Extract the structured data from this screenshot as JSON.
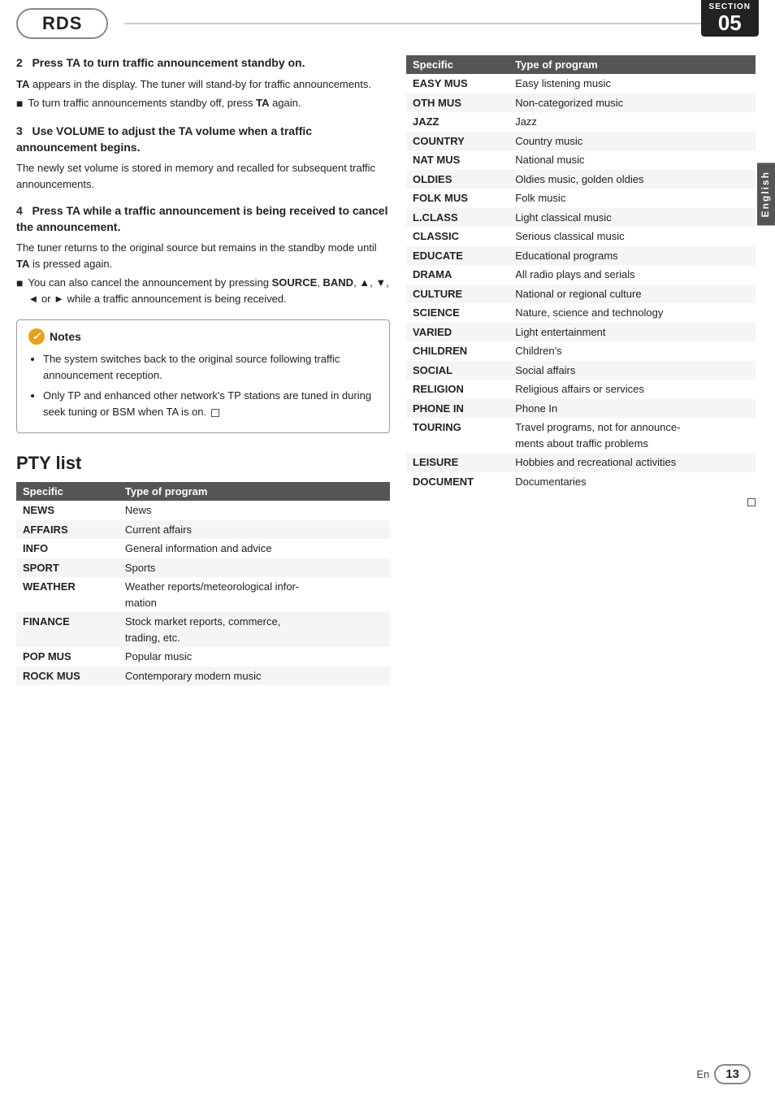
{
  "header": {
    "rds_label": "RDS",
    "section_label": "Section",
    "section_number": "05"
  },
  "sidebar": {
    "language": "English"
  },
  "steps": [
    {
      "id": "step2",
      "heading": "2   Press TA to turn traffic announcement standby on.",
      "paragraphs": [
        "TA appears in the display. The tuner will stand-by for traffic announcements.",
        "■   To turn traffic announcements standby off, press TA again."
      ]
    },
    {
      "id": "step3",
      "heading": "3   Use VOLUME to adjust the TA volume when a traffic announcement begins.",
      "paragraphs": [
        "The newly set volume is stored in memory and recalled for subsequent traffic announcements."
      ]
    },
    {
      "id": "step4",
      "heading": "4   Press TA while a traffic announcement is being received to cancel the announcement.",
      "paragraphs": [
        "The tuner returns to the original source but remains in the standby mode until TA is pressed again.",
        "■   You can also cancel the announcement by pressing SOURCE, BAND, ▲, ▼, ◄ or ► while a traffic announcement is being received."
      ]
    }
  ],
  "notes": {
    "title": "Notes",
    "items": [
      "The system switches back to the original source following traffic announcement reception.",
      "Only TP and enhanced other network's TP stations are tuned in during seek tuning or BSM when TA is on."
    ]
  },
  "pty_list": {
    "heading": "PTY list",
    "table1": {
      "headers": [
        "Specific",
        "Type of program"
      ],
      "rows": [
        [
          "NEWS",
          "News"
        ],
        [
          "AFFAIRS",
          "Current affairs"
        ],
        [
          "INFO",
          "General information and advice"
        ],
        [
          "SPORT",
          "Sports"
        ],
        [
          "WEATHER",
          "Weather reports/meteorological information"
        ],
        [
          "FINANCE",
          "Stock market reports, commerce, trading, etc."
        ],
        [
          "POP MUS",
          "Popular music"
        ],
        [
          "ROCK MUS",
          "Contemporary modern music"
        ]
      ]
    }
  },
  "pty_table2": {
    "headers": [
      "Specific",
      "Type of program"
    ],
    "rows": [
      [
        "EASY MUS",
        "Easy listening music"
      ],
      [
        "OTH MUS",
        "Non-categorized music"
      ],
      [
        "JAZZ",
        "Jazz"
      ],
      [
        "COUNTRY",
        "Country music"
      ],
      [
        "NAT MUS",
        "National music"
      ],
      [
        "OLDIES",
        "Oldies music, golden oldies"
      ],
      [
        "FOLK MUS",
        "Folk music"
      ],
      [
        "L.CLASS",
        "Light classical music"
      ],
      [
        "CLASSIC",
        "Serious classical music"
      ],
      [
        "EDUCATE",
        "Educational programs"
      ],
      [
        "DRAMA",
        "All radio plays and serials"
      ],
      [
        "CULTURE",
        "National or regional culture"
      ],
      [
        "SCIENCE",
        "Nature, science and technology"
      ],
      [
        "VARIED",
        "Light entertainment"
      ],
      [
        "CHILDREN",
        "Children's"
      ],
      [
        "SOCIAL",
        "Social affairs"
      ],
      [
        "RELIGION",
        "Religious affairs or services"
      ],
      [
        "PHONE IN",
        "Phone In"
      ],
      [
        "TOURING",
        "Travel programs, not for announcements about traffic problems"
      ],
      [
        "LEISURE",
        "Hobbies and recreational activities"
      ],
      [
        "DOCUMENT",
        "Documentaries"
      ]
    ]
  },
  "footer": {
    "en_label": "En",
    "page_number": "13"
  }
}
